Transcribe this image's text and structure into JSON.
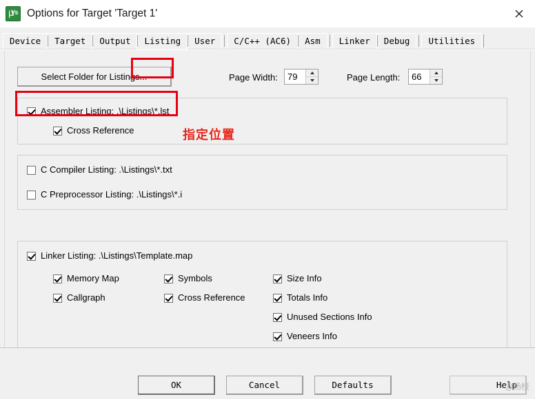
{
  "window": {
    "title": "Options for Target 'Target 1'",
    "app_icon": "keil-uvision-icon",
    "close_icon": "close-icon"
  },
  "tabs": [
    {
      "label": "Device",
      "selected": false
    },
    {
      "label": "Target",
      "selected": false
    },
    {
      "label": "Output",
      "selected": false
    },
    {
      "label": "Listing",
      "selected": true
    },
    {
      "label": "User",
      "selected": false
    },
    {
      "label": "C/C++ (AC6)",
      "selected": false
    },
    {
      "label": "Asm",
      "selected": false
    },
    {
      "label": "Linker",
      "selected": false
    },
    {
      "label": "Debug",
      "selected": false
    },
    {
      "label": "Utilities",
      "selected": false
    }
  ],
  "toolbar": {
    "select_folder_label": "Select Folder for Listings...",
    "page_width_label": "Page Width:",
    "page_width_value": "79",
    "page_length_label": "Page Length:",
    "page_length_value": "66"
  },
  "annotation": {
    "text": "指定位置",
    "color": "#e8261b"
  },
  "highlight": {
    "color": "#e60012"
  },
  "assembler_group": {
    "assembler_listing_label": "Assembler Listing:  .\\Listings\\*.lst",
    "assembler_listing_checked": true,
    "cross_reference_label": "Cross Reference",
    "cross_reference_checked": true
  },
  "compiler_group": {
    "c_compiler_listing_label": "C Compiler Listing:  .\\Listings\\*.txt",
    "c_compiler_listing_checked": false,
    "c_preprocessor_listing_label": "C Preprocessor Listing:  .\\Listings\\*.i",
    "c_preprocessor_listing_checked": false
  },
  "linker_group": {
    "linker_listing_label": "Linker Listing:  .\\Listings\\Template.map",
    "linker_listing_checked": true,
    "options": [
      {
        "label": "Memory Map",
        "checked": true,
        "col": 1,
        "row": 1
      },
      {
        "label": "Callgraph",
        "checked": true,
        "col": 1,
        "row": 2
      },
      {
        "label": "Symbols",
        "checked": true,
        "col": 2,
        "row": 1
      },
      {
        "label": "Cross Reference",
        "checked": true,
        "col": 2,
        "row": 2
      },
      {
        "label": "Size Info",
        "checked": true,
        "col": 3,
        "row": 1
      },
      {
        "label": "Totals Info",
        "checked": true,
        "col": 3,
        "row": 2
      },
      {
        "label": "Unused Sections Info",
        "checked": true,
        "col": 3,
        "row": 3
      },
      {
        "label": "Veneers Info",
        "checked": true,
        "col": 3,
        "row": 4
      }
    ]
  },
  "footer": {
    "ok_label": "OK",
    "cancel_label": "Cancel",
    "defaults_label": "Defaults",
    "help_label": "Help",
    "watermark": "@杨枝"
  }
}
